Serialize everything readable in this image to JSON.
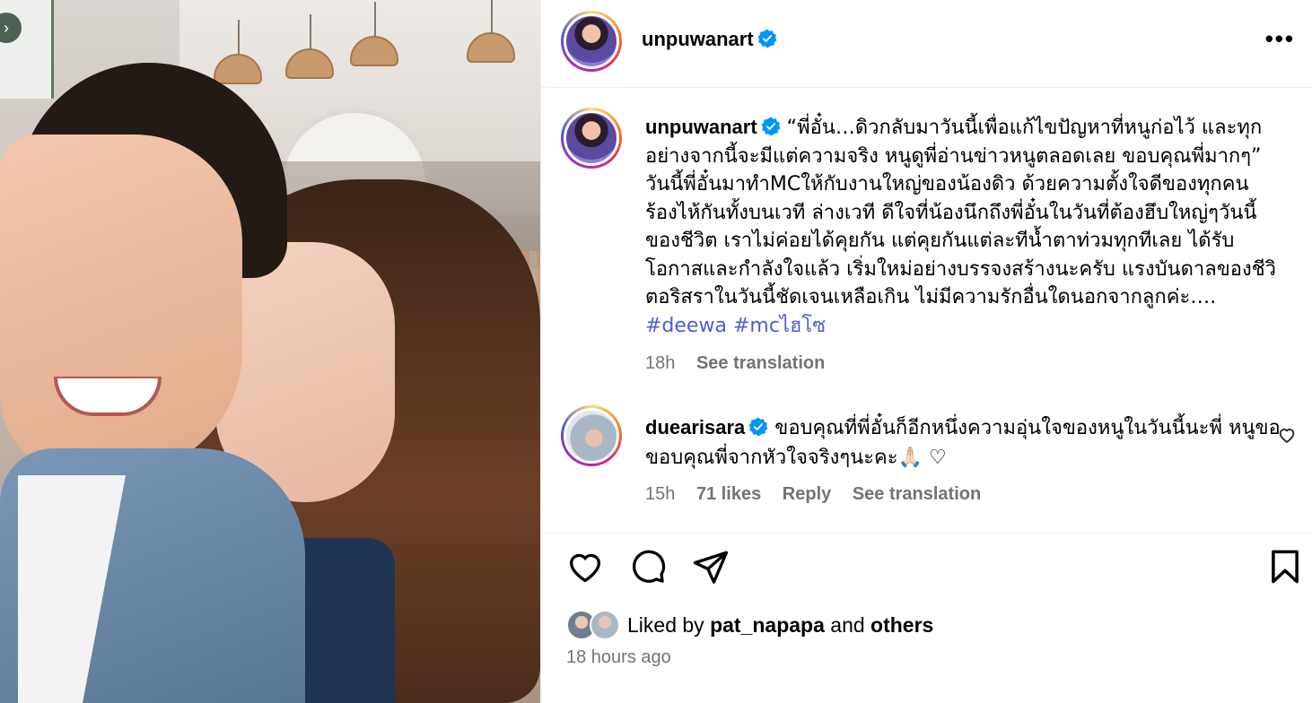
{
  "post": {
    "author": "unpuwanart",
    "verified": true,
    "caption": "“พี่อั๋น…ดิวกลับมาวันนี้เพื่อแก้ไขปัญหาที่หนูก่อไว้ และทุกอย่างจากนี้จะมีแต่ความจริง หนูดูพี่อ่านข่าวหนูตลอดเลย ขอบคุณพี่มากๆ” วันนี้พี่อั๋นมาทำMCให้กับงานใหญ่ของน้องดิว ด้วยความตั้งใจดีของทุกคน ร้องไห้กันทั้งบนเวที ล่างเวที ดีใจที่น้องนึกถึงพี่อั๋นในวันที่ต้องฮึบใหญ่ๆวันนี้ของชีวิต เราไม่ค่อยได้คุยกัน แต่คุยกันแต่ละทีน้ำตาท่วมทุกทีเลย ได้รับโอกาสและกำลังใจแล้ว เริ่มใหม่อย่างบรรจงสร้างนะครับ แรงบันดาลของชีวิตอริสราในวันนี้ชัดเจนเหลือเกิน ไม่มีความรักอื่นใดนอกจากลูกค่ะ….",
    "hashtags": [
      "#deewa",
      "#mcไฮโซ"
    ],
    "caption_time": "18h",
    "see_translation": "See translation"
  },
  "comment": {
    "author": "duearisara",
    "verified": true,
    "text": "ขอบคุณที่พี่อั๋นก็อีกหนึ่งความอุ่นใจของหนูในวันนี้นะพี่ หนูขอขอบคุณพี่จากหัวใจจริงๆนะคะ🙏🏻 ♡",
    "time": "15h",
    "likes": "71 likes",
    "reply": "Reply",
    "see_translation": "See translation"
  },
  "likes": {
    "prefix": "Liked by",
    "user": "pat_napapa",
    "and": "and",
    "others": "others"
  },
  "time_ago": "18 hours ago",
  "more_menu": "•••",
  "icons": {
    "verified": "verified-badge-icon",
    "like": "heart-icon",
    "comment": "comment-bubble-icon",
    "share": "paper-plane-icon",
    "save": "bookmark-icon",
    "more": "more-horizontal-icon"
  },
  "colors": {
    "verified_blue": "#0095f6",
    "hashtag": "#4d5fcc",
    "meta_gray": "#737373"
  }
}
